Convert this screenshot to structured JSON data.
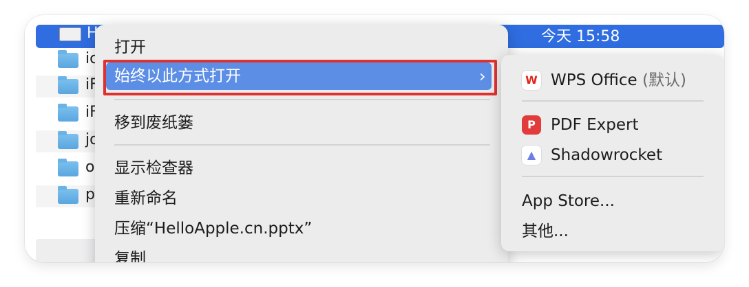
{
  "finder": {
    "selected_row": {
      "name_fragment": "H",
      "date": "今天 15:58"
    },
    "rows": [
      {
        "letter": "ic"
      },
      {
        "letter": "iF"
      },
      {
        "letter": "iF"
      },
      {
        "letter": "jo"
      },
      {
        "letter": "o"
      },
      {
        "letter": "p"
      }
    ]
  },
  "context_menu": {
    "open": "打开",
    "open_with": "始终以此方式打开",
    "open_with_chevron": "›",
    "move_to_trash": "移到废纸篓",
    "show_inspector": "显示检查器",
    "rename": "重新命名",
    "compress": "压缩“HelloApple.cn.pptx”",
    "copy_partial": "复制"
  },
  "submenu": {
    "wps": {
      "name": "WPS Office",
      "suffix": "(默认)",
      "icon": "wps-office-icon"
    },
    "pdf_expert": {
      "name": "PDF Expert",
      "icon": "pdf-expert-icon"
    },
    "shadowrocket": {
      "name": "Shadowrocket",
      "icon": "shadowrocket-icon"
    },
    "app_store": "App Store...",
    "other": "其他..."
  },
  "colors": {
    "selection_blue": "#2f6de0",
    "menu_highlight": "#5c8ee6",
    "annotation_red": "#e03131",
    "menu_bg": "#ececec"
  }
}
